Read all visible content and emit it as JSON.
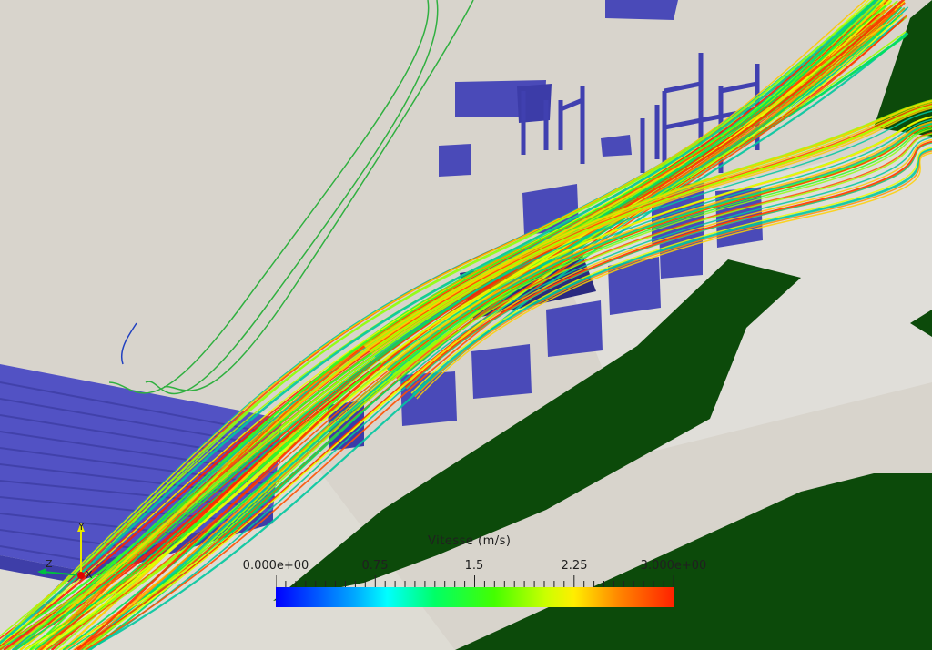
{
  "colorbar": {
    "title": "Vitesse  (m/s)",
    "tick_min": "0.000e+00",
    "tick_1": "0.75",
    "tick_2": "1.5",
    "tick_3": "2.25",
    "tick_max": "3.000e+00"
  },
  "axes": {
    "y": "Y",
    "z": "Z",
    "x": "X"
  },
  "colors": {
    "background": "#dcd8d0",
    "structures": "#4a4ab8",
    "vegetation": "#0c4a0a"
  }
}
